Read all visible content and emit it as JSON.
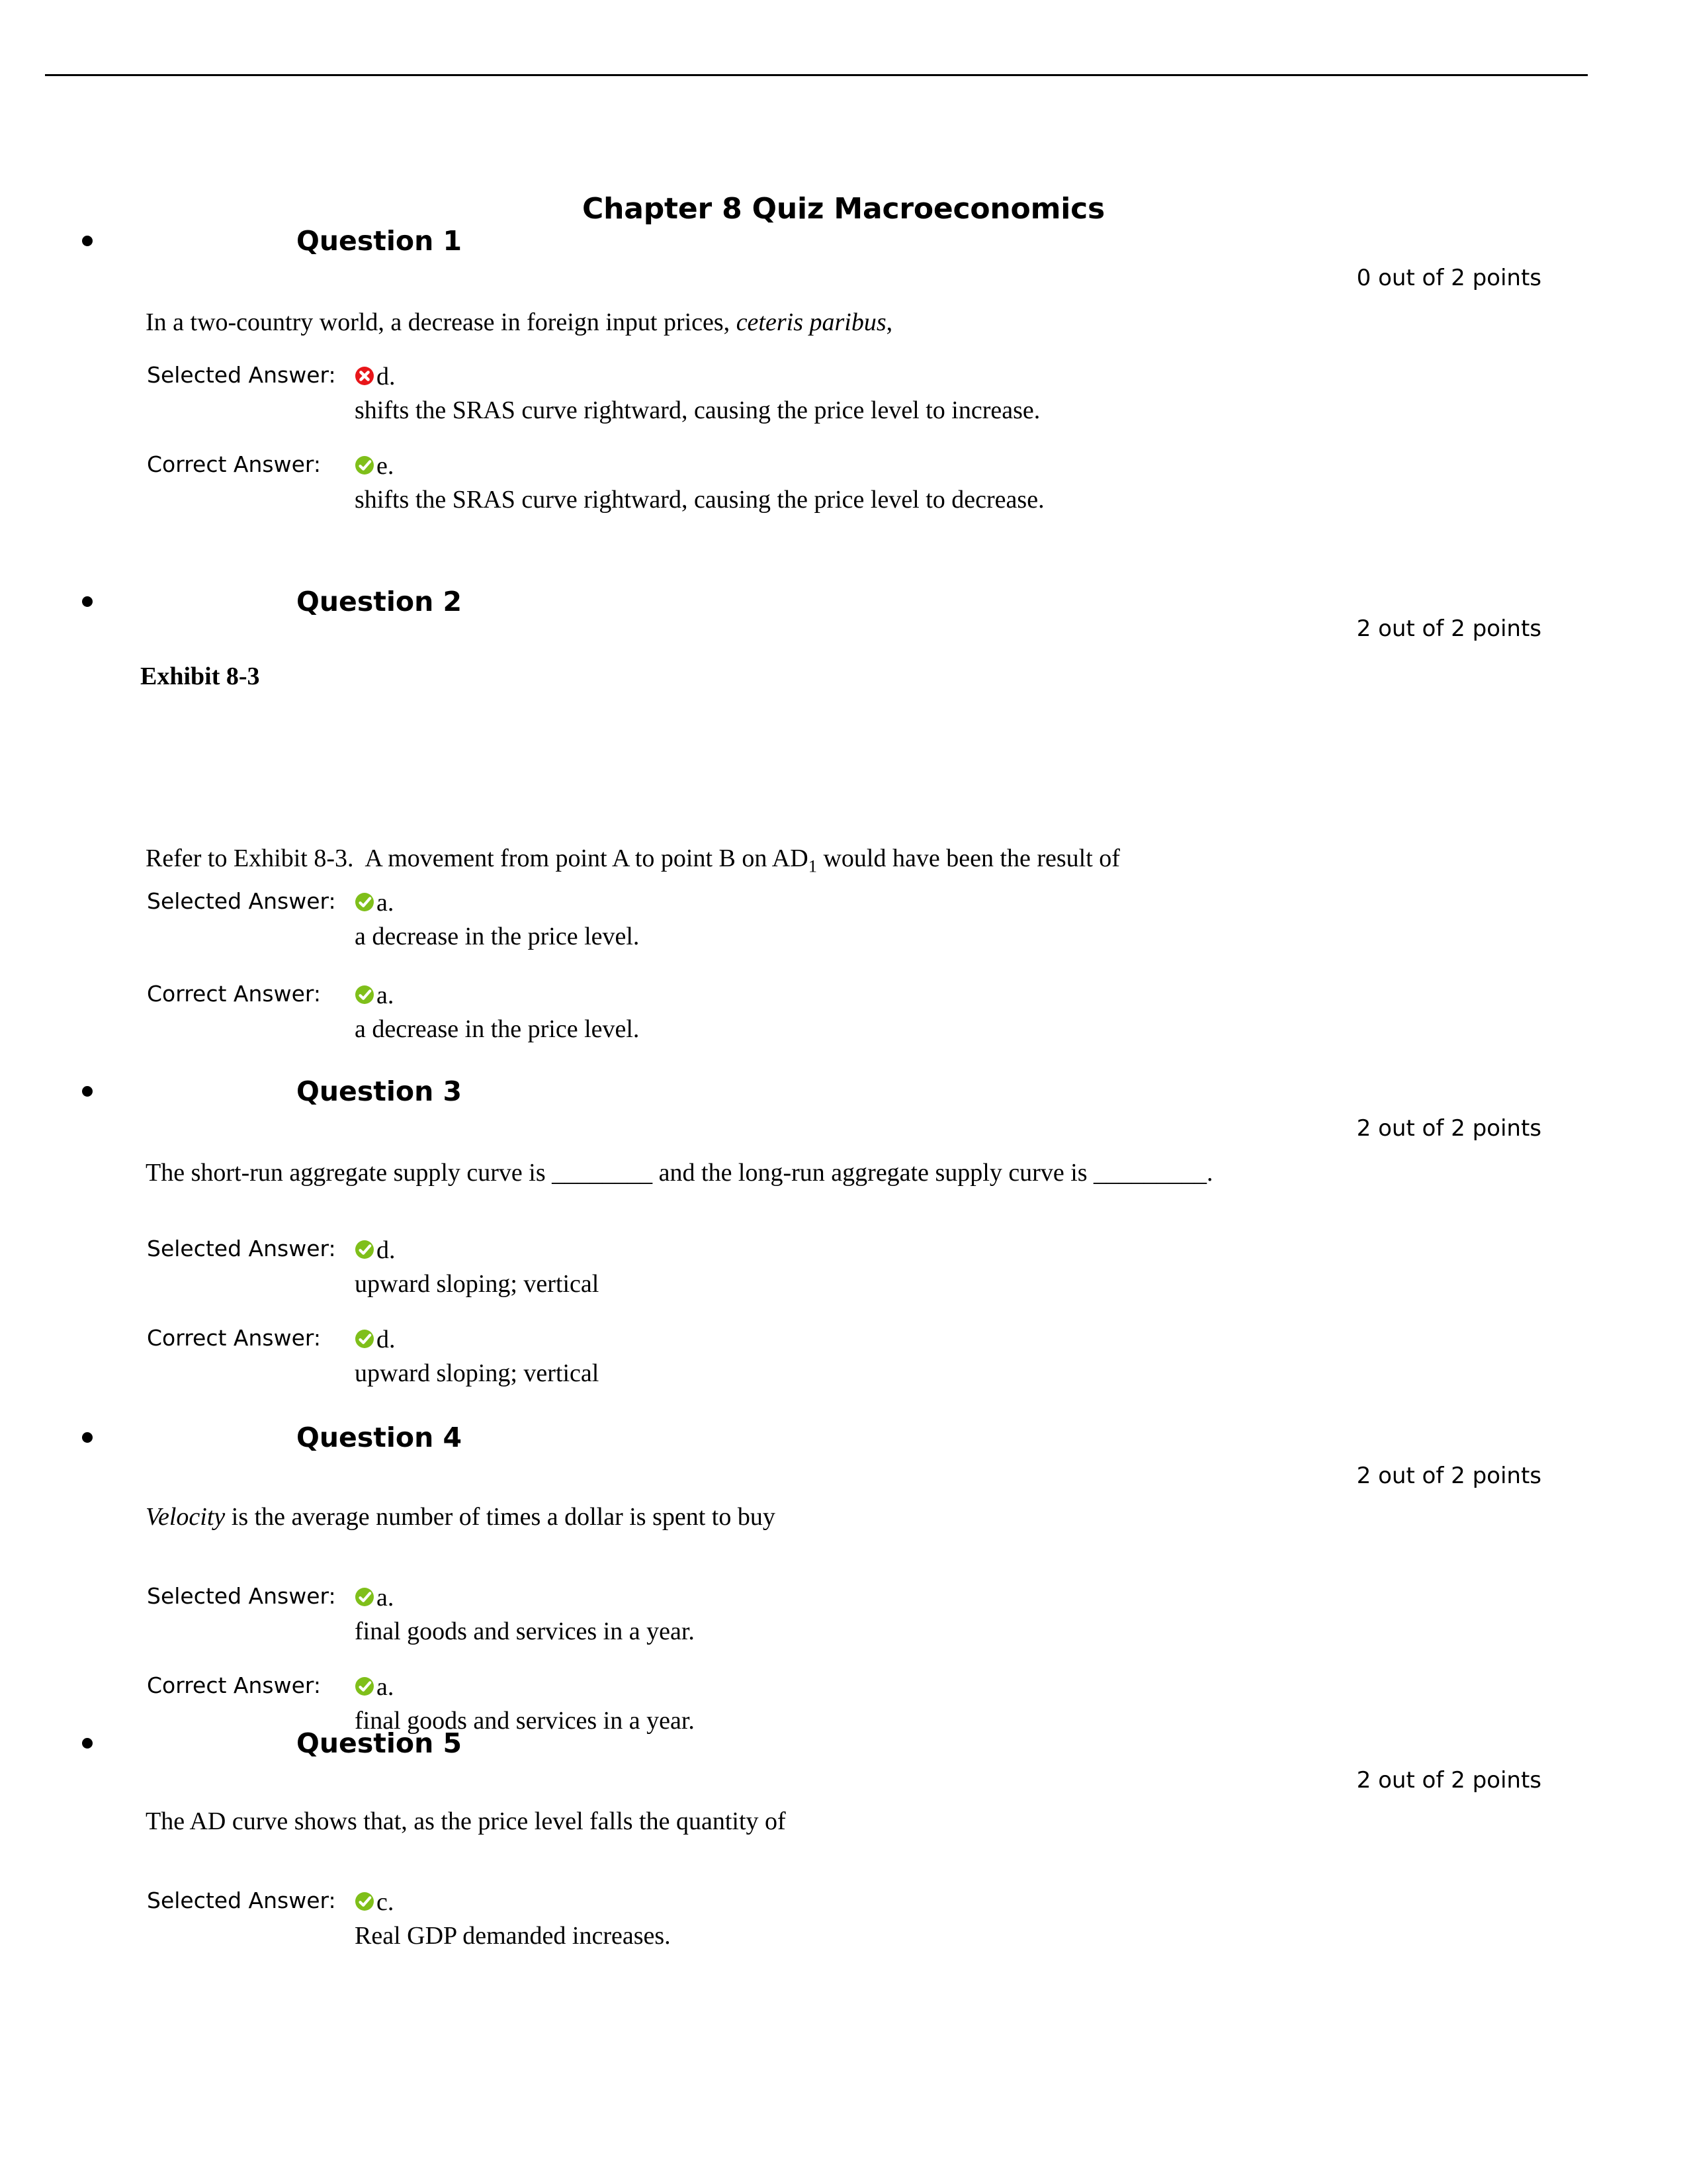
{
  "document": {
    "title": "Chapter 8 Quiz Macroeconomics",
    "labels": {
      "selected_answer": "Selected Answer:",
      "correct_answer": "Correct Answer:"
    },
    "icons": {
      "correct": "green-check-circle-icon",
      "incorrect": "red-x-circle-icon"
    },
    "colors": {
      "correct_green": "#7FBF1A",
      "incorrect_red": "#E8161A",
      "text": "#000000",
      "rule": "#000000",
      "page_background": "#FFFFFF"
    }
  },
  "questions": [
    {
      "heading": "Question 1",
      "points": "0 out of 2 points",
      "stem_html": "In a two-country world, a decrease in foreign input prices, <i>ceteris paribus</i>,",
      "exhibit_label": null,
      "answers": [
        {
          "label": "Selected Answer:",
          "status": "incorrect",
          "letter": "d.",
          "text": "shifts the SRAS curve rightward, causing the price level to increase."
        },
        {
          "label": "Correct Answer:",
          "status": "correct",
          "letter": "e.",
          "text": "shifts the SRAS curve rightward, causing the price level to decrease."
        }
      ]
    },
    {
      "heading": "Question 2",
      "points": "2 out of 2 points",
      "exhibit_label": "Exhibit 8-3",
      "stem_html": "Refer to Exhibit 8-3.&nbsp; A movement from point A to point B on AD<sub>1</sub> would have been the result of",
      "answers": [
        {
          "label": "Selected Answer:",
          "status": "correct",
          "letter": "a.",
          "text": "a decrease in the price level."
        },
        {
          "label": "Correct Answer:",
          "status": "correct",
          "letter": "a.",
          "text": "a decrease in the price level."
        }
      ]
    },
    {
      "heading": "Question 3",
      "points": "2 out of 2 points",
      "exhibit_label": null,
      "stem_html": "The short-run aggregate supply curve is ________ and the long-run aggregate supply curve is _________.",
      "answers": [
        {
          "label": "Selected Answer:",
          "status": "correct",
          "letter": "d.",
          "text": "upward sloping; vertical"
        },
        {
          "label": "Correct Answer:",
          "status": "correct",
          "letter": "d.",
          "text": "upward sloping; vertical"
        }
      ]
    },
    {
      "heading": "Question 4",
      "points": "2 out of 2 points",
      "exhibit_label": null,
      "stem_html": "<i>Velocity</i> is the average number of times a dollar is spent to buy",
      "answers": [
        {
          "label": "Selected Answer:",
          "status": "correct",
          "letter": "a.",
          "text": "final goods and services in a year."
        },
        {
          "label": "Correct Answer:",
          "status": "correct",
          "letter": "a.",
          "text": "final goods and services in a year."
        }
      ]
    },
    {
      "heading": "Question 5",
      "points": "2 out of 2 points",
      "exhibit_label": null,
      "stem_html": "The AD curve shows that, as the price level falls the quantity of",
      "answers": [
        {
          "label": "Selected Answer:",
          "status": "correct",
          "letter": "c.",
          "text": "Real GDP demanded increases."
        }
      ]
    }
  ],
  "layout": {
    "question_tops": [
      340,
      885,
      1625,
      2148,
      2610
    ],
    "points_tops": [
      400,
      930,
      1685,
      2210,
      2670
    ],
    "stem_tops": [
      460,
      1270,
      1745,
      2265,
      2725
    ],
    "exhibit_label_tops": {
      "1": 1000
    },
    "answer_row_tops": [
      [
        545,
        680
      ],
      [
        1340,
        1480
      ],
      [
        1865,
        2000
      ],
      [
        2390,
        2525
      ],
      [
        2850
      ]
    ]
  }
}
